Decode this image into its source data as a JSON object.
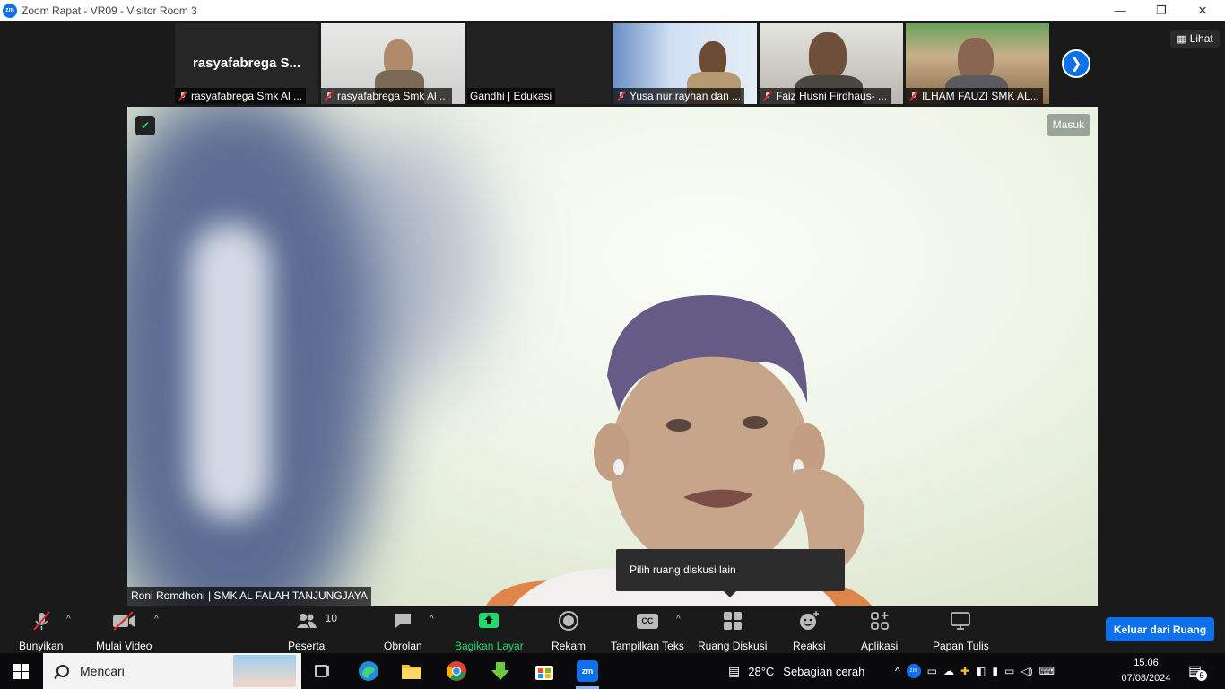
{
  "window": {
    "title": "Zoom Rapat - VR09 - Visitor Room 3",
    "logo": "zm"
  },
  "strip": {
    "tiles": [
      {
        "name": "rasyafabrega Smk Al ...",
        "big": "rasyafabrega  S..."
      },
      {
        "name": "rasyafabrega Smk Al ..."
      },
      {
        "name": "Gandhi | Edukasi"
      },
      {
        "name": "Yusa nur rayhan dan ..."
      },
      {
        "name": "Faiz Husni Firdhaus- ..."
      },
      {
        "name": "ILHAM FAUZI SMK AL..."
      }
    ],
    "view_label": "Lihat"
  },
  "main": {
    "speaker": "Roni Romdhoni | SMK AL FALAH TANJUNGJAYA",
    "join_badge": "Masuk",
    "tooltip": "Pilih ruang diskusi lain"
  },
  "toolbar": {
    "unmute": "Bunyikan",
    "start_video": "Mulai Video",
    "participants": "Peserta",
    "participants_count": "10",
    "chat": "Obrolan",
    "share": "Bagikan Layar",
    "record": "Rekam",
    "captions": "Tampilkan Teks",
    "cc": "CC",
    "breakout": "Ruang Diskusi",
    "reactions": "Reaksi",
    "apps": "Aplikasi",
    "whiteboard": "Papan Tulis",
    "leave": "Keluar dari Ruang"
  },
  "taskbar": {
    "search": "Mencari",
    "zoom_app": "zm",
    "weather": "28°C",
    "weather_desc": "Sebagian cerah",
    "tray_zoom": "zm",
    "time": "15.06",
    "date": "07/08/2024",
    "notifications": "5"
  },
  "colors": {
    "accent": "#0e71eb",
    "share_green": "#23d96c",
    "mute_red": "#e02828"
  }
}
